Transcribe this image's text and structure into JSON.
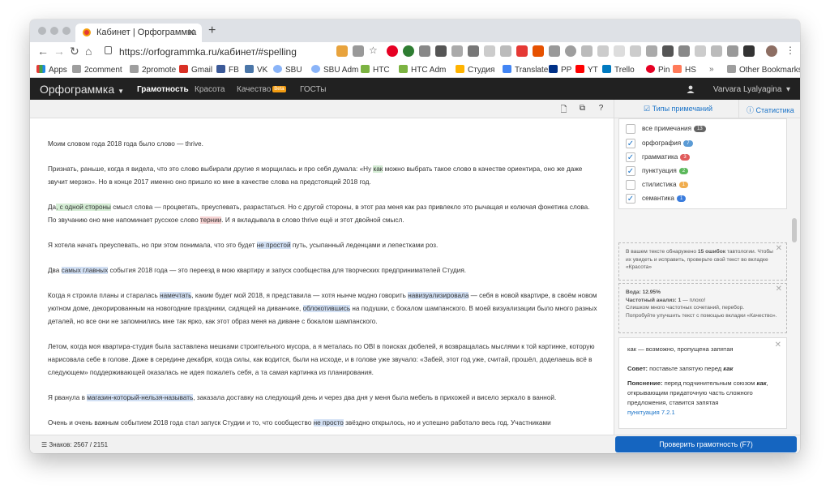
{
  "browser": {
    "tab_title": "Кабинет | Орфограммка",
    "url": "https://orfogrammka.ru/кабинет/#spelling",
    "bookmarks": [
      "Apps",
      "2comment",
      "2promote",
      "Gmail",
      "FB",
      "VK",
      "SBU",
      "SBU Adm",
      "HTC",
      "HTC Adm",
      "Студия",
      "Translate",
      "PP",
      "YT",
      "Trello",
      "Pin",
      "HS"
    ],
    "other_bookmarks": "Other Bookmarks",
    "more": "»"
  },
  "app": {
    "brand": "Орфограммка",
    "nav": [
      "Грамотность",
      "Красота",
      "Качество",
      "ГОСТы"
    ],
    "beta": "Beta",
    "user": "Varvara Lyalyagina"
  },
  "subbar": {
    "types": "Типы примечаний",
    "stats": "Статистика"
  },
  "text": {
    "p1": "Моим словом года 2018 года было слово — thrive.",
    "p2a": "Признать, раньше, когда я видела, что это слово выбирали другие я морщилась и про себя думала: «Ну ",
    "p2b": "как",
    "p2c": " можно выбрать такое слово в качестве ориентира, оно же даже звучит мерзко». Но в конце 2017 именно оно пришло ко мне в качестве слова на предстоящий 2018 год.",
    "p3a": "Да",
    "p3b": ", с одной стороны",
    "p3c": " смысл слова — процветать, преуспевать, разрастаться. Но с другой стороны, в этот раз меня как раз привлекло это рычащая и колючая фонетика слова. По звучанию оно мне напоминает русское слово ",
    "p3d": "тернии",
    "p3e": ". И я вкладывала в слово thrive ещё и этот двойной смысл.",
    "p4a": "Я хотела начать преуспевать, но при этом понимала, что это будет ",
    "p4b": "не простой",
    "p4c": " путь, усыпанный леденцами и лепестками роз.",
    "p5a": "Два ",
    "p5b": "самых главных",
    "p5c": " события 2018 года — это переезд в мою квартиру и запуск сообщества для творческих предпринимателей Студия.",
    "p6a": "Когда я строила планы и старалась ",
    "p6b": "намечтать",
    "p6c": ", каким будет мой 2018, я представила — хотя нынче модно говорить ",
    "p6d": "навизуализировала",
    "p6e": " — себя в новой квартире, в своём новом уютном доме, декорированным на новогодние праздники, сидящей на диванчике, ",
    "p6f": "облокотившись",
    "p6g": " на подушки, с бокалом шампанского. В моей визуализации было много разных деталей, но все они не запомнились мне так ярко, как этот образ меня на диване с бокалом шампанского.",
    "p7": "Летом, когда моя квартира-студия была заставлена мешками строительного мусора, а я металась по OBI в поисках дюбелей, я возвращалась мыслями к той картинке, которую нарисовала себе в голове. Даже в середине декабря, когда силы, как водится, были на исходе, и в голове уже звучало: «Забей, этот год уже, считай, прошёл, доделаешь всё в следующем» поддерживающей оказалась не идея пожалеть себя, а та самая картинка из планирования.",
    "p8a": "Я рванула в ",
    "p8b": "магазин-который-нельзя-называть",
    "p8c": ", заказала доставку на следующий день и через два дня у меня была мебель в прихожей и висело зеркало в ванной.",
    "p9a": "Очень и очень важным событием 2018 года стал запуск Студии и то, что сообщество ",
    "p9b": "не просто",
    "p9c": " звёздно открылось, но и успешно работало весь год. Участниками"
  },
  "filters": [
    {
      "label": "все примечания",
      "count": "13",
      "color": "#666666",
      "checked": false
    },
    {
      "label": "орфография",
      "count": "7",
      "color": "#5b9bd5",
      "checked": true
    },
    {
      "label": "грамматика",
      "count": "3",
      "color": "#e05a5a",
      "checked": true
    },
    {
      "label": "пунктуация",
      "count": "2",
      "color": "#5cb85c",
      "checked": true
    },
    {
      "label": "стилистика",
      "count": "1",
      "color": "#f0ad4e",
      "checked": false
    },
    {
      "label": "семантика",
      "count": "1",
      "color": "#3b7ddd",
      "checked": true
    }
  ],
  "hint1": {
    "a": "В вашем тексте обнаружено ",
    "b": "15 ошибок",
    "c": " тавтологии. Чтобы их увидеть и исправить, проверьте свой текст во вкладке «Красота»"
  },
  "hint2": {
    "l1": "Вода: 12.95%",
    "l2a": "Частотный анализ: 1",
    "l2b": " — плохо!",
    "l3": "Слишком много частотных сочетаний, перебор.",
    "l4": "Попробуйте улучшить текст с помощью вкладки «Качество»."
  },
  "card": {
    "title": "как — возможно, пропущена запятая",
    "advice_label": "Совет:",
    "advice": " поставьте запятую перед ",
    "advice_word": "как",
    "expl_label": "Пояснение:",
    "expl1": " перед подчинительным союзом ",
    "expl_word": "как",
    "expl2": ", открывающим придаточную часть сложного предложения, ставится запятая",
    "rule": "пунктуация 7.2.1"
  },
  "footer": {
    "count": "Знаков: 2567 / 2151",
    "button": "Проверить грамотность (F7)"
  },
  "colors": {
    "accent": "#1565c0",
    "dark_nav": "#212121"
  }
}
